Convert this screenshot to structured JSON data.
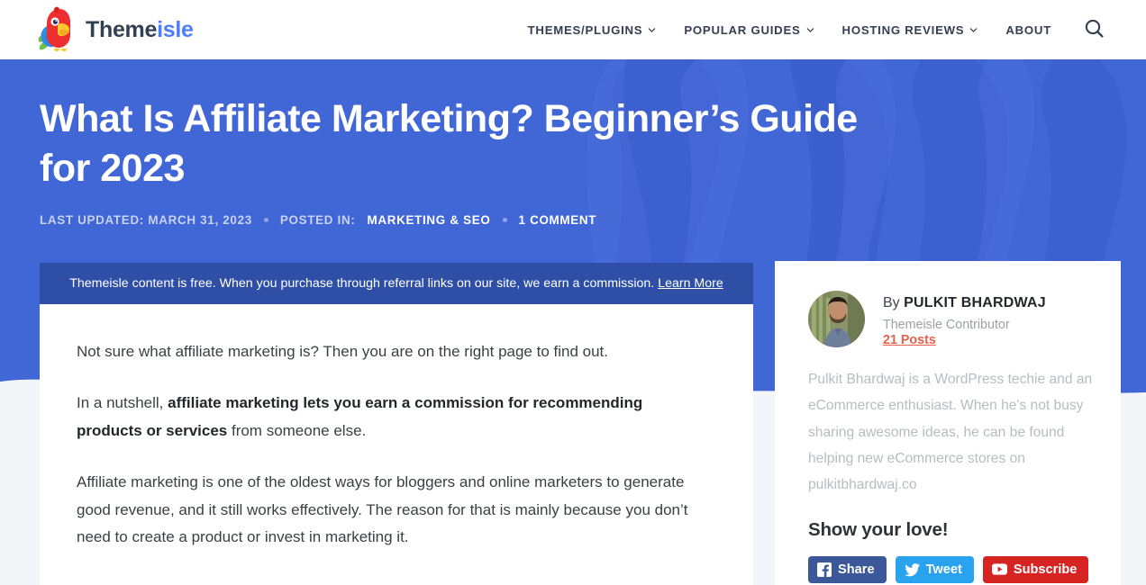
{
  "header": {
    "brand": {
      "text_dark": "Theme",
      "text_accent": "isle",
      "logo_icon": "parrot-logo-icon"
    },
    "nav": [
      {
        "label": "THEMES/PLUGINS",
        "has_dropdown": true
      },
      {
        "label": "POPULAR GUIDES",
        "has_dropdown": true
      },
      {
        "label": "HOSTING REVIEWS",
        "has_dropdown": true
      },
      {
        "label": "ABOUT",
        "has_dropdown": false
      }
    ],
    "search_icon": "search-icon"
  },
  "hero": {
    "title": "What Is Affiliate Marketing? Beginner’s Guide for 2023",
    "meta": {
      "updated_label": "LAST UPDATED: MARCH 31, 2023",
      "posted_in_label": "POSTED IN:",
      "category": "MARKETING & SEO",
      "comments": "1 COMMENT"
    },
    "background_color": "#4166d5"
  },
  "content": {
    "disclosure": {
      "text": "Themeisle content is free. When you purchase through referral links on our site, we earn a commission.",
      "link_label": "Learn More",
      "background_color": "#2f4fa6"
    },
    "paragraphs": [
      {
        "parts": [
          {
            "t": "Not sure what affiliate marketing is? Then you are on the right page to find out.",
            "b": false
          }
        ]
      },
      {
        "parts": [
          {
            "t": "In a nutshell, ",
            "b": false
          },
          {
            "t": "affiliate marketing lets you earn a commission for recommending products or services",
            "b": true
          },
          {
            "t": " from someone else.",
            "b": false
          }
        ]
      },
      {
        "parts": [
          {
            "t": "Affiliate marketing is one of the oldest ways for bloggers and online marketers to generate good revenue, and it still works effectively. The reason for that is mainly because you don’t need to create a product or invest in marketing it.",
            "b": false
          }
        ]
      }
    ]
  },
  "sidebar": {
    "author": {
      "by_label": "By",
      "name": "PULKIT BHARDWAJ",
      "role": "Themeisle Contributor",
      "posts": "21 Posts",
      "posts_color": "#e8604c",
      "avatar_icon": "author-avatar",
      "bio": "Pulkit Bhardwaj is a WordPress techie and an eCommerce enthusiast. When he's not busy sharing awesome ideas, he can be found helping new eCommerce stores on pulkitbhardwaj.co"
    },
    "share": {
      "title": "Show your love!",
      "buttons": [
        {
          "label": "Share",
          "icon": "facebook-icon",
          "color": "#3b5998"
        },
        {
          "label": "Tweet",
          "icon": "twitter-icon",
          "color": "#2aa3ef"
        },
        {
          "label": "Subscribe",
          "icon": "youtube-icon",
          "color": "#d62423"
        }
      ]
    }
  }
}
